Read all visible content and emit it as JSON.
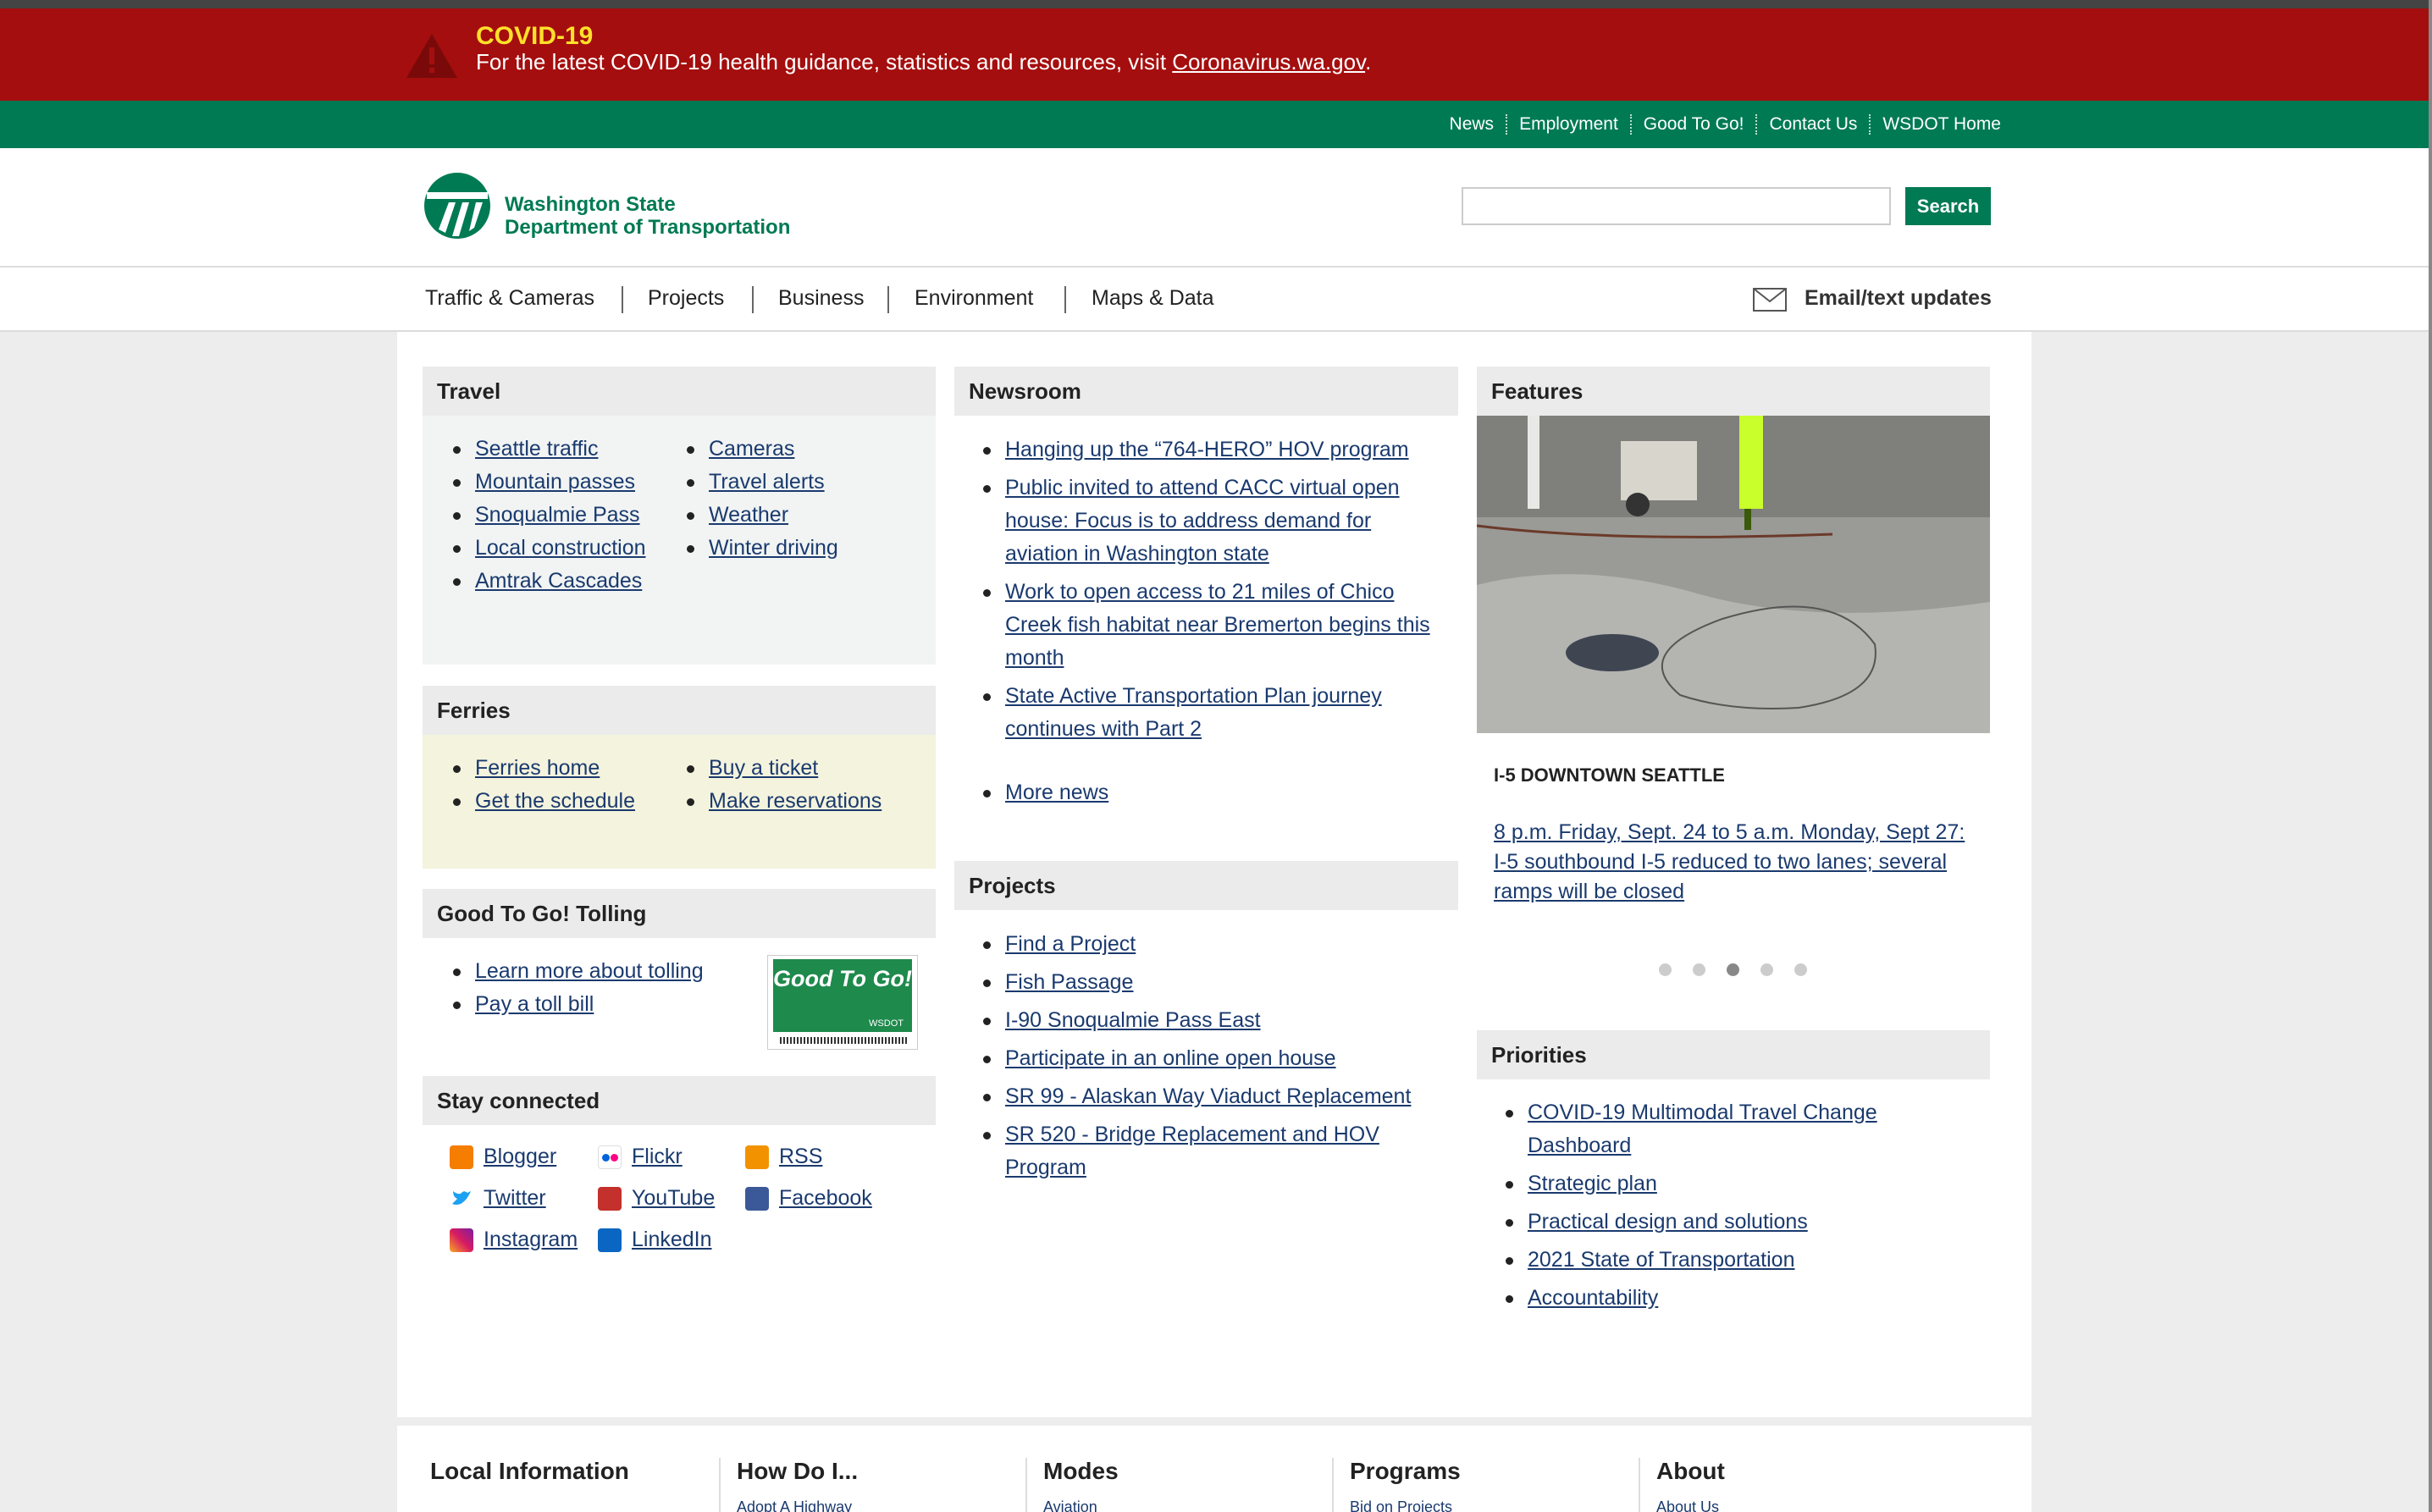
{
  "alert": {
    "title": "COVID-19",
    "text": "For the latest COVID-19 health guidance, statistics and resources, visit ",
    "link": "Coronavirus.wa.gov",
    "suffix": "."
  },
  "utility_nav": [
    "News",
    "Employment",
    "Good To Go!",
    "Contact Us",
    "WSDOT Home"
  ],
  "logo": {
    "line1": "Washington State",
    "line2": "Department of Transportation"
  },
  "search": {
    "placeholder": "",
    "button": "Search"
  },
  "main_nav": [
    "Traffic & Cameras",
    "Projects",
    "Business",
    "Environment",
    "Maps & Data"
  ],
  "email_updates": "Email/text updates",
  "travel": {
    "title": "Travel",
    "left": [
      "Seattle traffic",
      "Mountain passes",
      "Snoqualmie Pass",
      "Local construction",
      "Amtrak Cascades"
    ],
    "right": [
      "Cameras",
      "Travel alerts",
      "Weather",
      "Winter driving"
    ]
  },
  "ferries": {
    "title": "Ferries",
    "left": [
      "Ferries home",
      "Get the schedule"
    ],
    "right": [
      "Buy a ticket",
      "Make reservations"
    ]
  },
  "tolling": {
    "title": "Good To Go! Tolling",
    "links": [
      "Learn more about tolling",
      "Pay a toll bill"
    ],
    "badge_text": "Good To Go!",
    "badge_sub": "WSDOT"
  },
  "stay_connected": {
    "title": "Stay connected",
    "items": [
      "Blogger",
      "Flickr",
      "RSS",
      "Twitter",
      "YouTube",
      "Facebook",
      "Instagram",
      "LinkedIn"
    ]
  },
  "newsroom": {
    "title": "Newsroom",
    "items": [
      "Hanging up the “764-HERO” HOV program",
      "Public invited to attend CACC virtual open house: Focus is to address demand for aviation in Washington state",
      "Work to open access to 21 miles of Chico Creek fish habitat near Bremerton begins this month",
      "State Active Transportation Plan journey continues with Part 2"
    ],
    "more": "More news"
  },
  "projects": {
    "title": "Projects",
    "items": [
      "Find a Project",
      "Fish Passage",
      "I-90 Snoqualmie Pass East",
      "Participate in an online open house",
      "SR 99 - Alaskan Way Viaduct Replacement",
      "SR 520 - Bridge Replacement and HOV Program"
    ]
  },
  "features": {
    "title": "Features",
    "caption_title": "I-5 DOWNTOWN SEATTLE",
    "caption_link": "8 p.m. Friday, Sept. 24 to 5 a.m. Monday, Sept 27: I-5 southbound I-5 reduced to two lanes; several ramps will be closed",
    "slide_count": 5,
    "active_slide": 3
  },
  "priorities": {
    "title": "Priorities",
    "items": [
      "COVID-19 Multimodal Travel Change Dashboard",
      "Strategic plan",
      "Practical design and solutions",
      "2021 State of Transportation",
      "Accountability"
    ]
  },
  "footer": {
    "columns": [
      {
        "title": "Local Information",
        "sub": ""
      },
      {
        "title": "How Do I...",
        "sub": "Adopt A Highway"
      },
      {
        "title": "Modes",
        "sub": "Aviation"
      },
      {
        "title": "Programs",
        "sub": "Bid on Projects"
      },
      {
        "title": "About",
        "sub": "About Us"
      }
    ]
  },
  "colors": {
    "alert_red": "#a50e0e",
    "alert_title": "#ffe02a",
    "brand_green": "#007a53",
    "link": "#1a3a6e"
  }
}
